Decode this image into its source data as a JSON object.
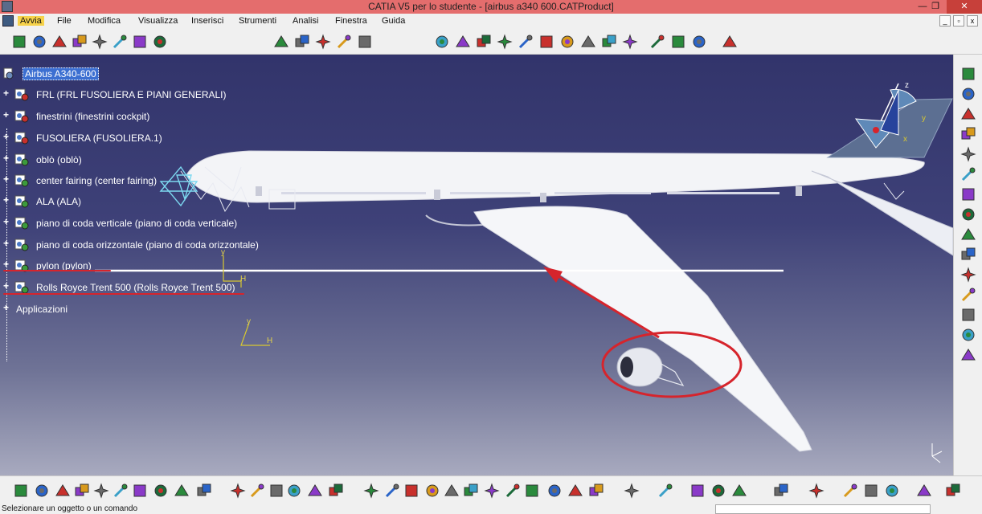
{
  "window": {
    "title": "CATIA V5 per lo studente - [airbus a340 600.CATProduct]",
    "controls": {
      "minimize": "—",
      "maximize": "❐",
      "close": "✕"
    }
  },
  "menu": {
    "items": [
      "Avvia",
      "File",
      "Modifica",
      "Visualizza",
      "Inserisci",
      "Strumenti",
      "Analisi",
      "Finestra",
      "Guida"
    ],
    "doc_controls": {
      "minimize": "_",
      "restore": "▫",
      "close": "x"
    }
  },
  "tree": {
    "root": "Airbus A340-600",
    "nodes": [
      "FRL (FRL FUSOLIERA E PIANI GENERALI)",
      "finestrini (finestrini cockpit)",
      "FUSOLIERA (FUSOLIERA.1)",
      "oblò (oblò)",
      "center fairing (center fairing)",
      "ALA (ALA)",
      "piano di coda verticale (piano di coda verticale)",
      "piano di coda orizzontale (piano di coda orizzontale)",
      "pylon (pylon)",
      "Rolls Royce Trent 500 (Rolls Royce Trent 500)"
    ],
    "applications": "Applicazioni",
    "expand_symbol": "+"
  },
  "axis_labels": {
    "x": "x",
    "y": "y",
    "z": "z",
    "h": "H"
  },
  "colors": {
    "title_bar": "#e46d6d",
    "viewport_top": "#32346b",
    "annotation_red": "#d6242c",
    "selection_blue": "#3c6fd1"
  },
  "status": {
    "message": "Selezionare un oggetto o un comando"
  },
  "icons": {
    "top_toolbar": [
      "move-icon",
      "snap-icon",
      "manipulate-icon",
      "explode-icon",
      "clash-icon",
      "stop-manipulate-icon",
      "measure-icon",
      "product-icon",
      "components-icon",
      "sketcher-icon",
      "dimension-icon",
      "annotation-icon",
      "constraint-icon",
      "update-icon",
      "catalog-icon",
      "scene-icon",
      "render-icon",
      "analyze-icon",
      "assembly-icon",
      "shape-icon",
      "sectioning-icon",
      "space-analysis-icon",
      "tools-icon",
      "options-icon",
      "view-icon",
      "render-style-icon",
      "hide-show-icon"
    ],
    "right_toolbar": [
      "knowledge-icon",
      "select-arrow-icon",
      "product-structure-icon",
      "insert-component-icon",
      "existing-component-icon",
      "replace-icon",
      "graph-tree-icon",
      "generate-numbering-icon",
      "selective-load-icon",
      "manage-representations-icon",
      "multi-instantiation-icon",
      "reorder-icon",
      "component-properties-icon",
      "assembly-features-icon",
      "publication-icon"
    ],
    "bottom_toolbar": [
      "new-icon",
      "open-icon",
      "save-icon",
      "print-icon",
      "cut-icon",
      "copy-icon",
      "paste-icon",
      "undo-icon",
      "redo-icon",
      "whats-this-icon",
      "formula-icon",
      "comment-icon",
      "link-icon",
      "table-icon",
      "material-icon",
      "macro-icon",
      "fly-icon",
      "fit-all-icon",
      "pan-icon",
      "rotate-icon",
      "zoom-in-icon",
      "zoom-out-icon",
      "normal-view-icon",
      "multi-view-icon",
      "iso-view-icon",
      "shading-icon",
      "shading-edges-icon",
      "hide-icon",
      "capture-icon",
      "swap-icon",
      "specifications-icon",
      "geometry-icon",
      "compass-icon",
      "eraser-icon",
      "catia-icon",
      "catalog-browser-icon",
      "sphere-icon",
      "material-library-icon",
      "grid-icon",
      "3ds-catia-logo-icon"
    ]
  }
}
